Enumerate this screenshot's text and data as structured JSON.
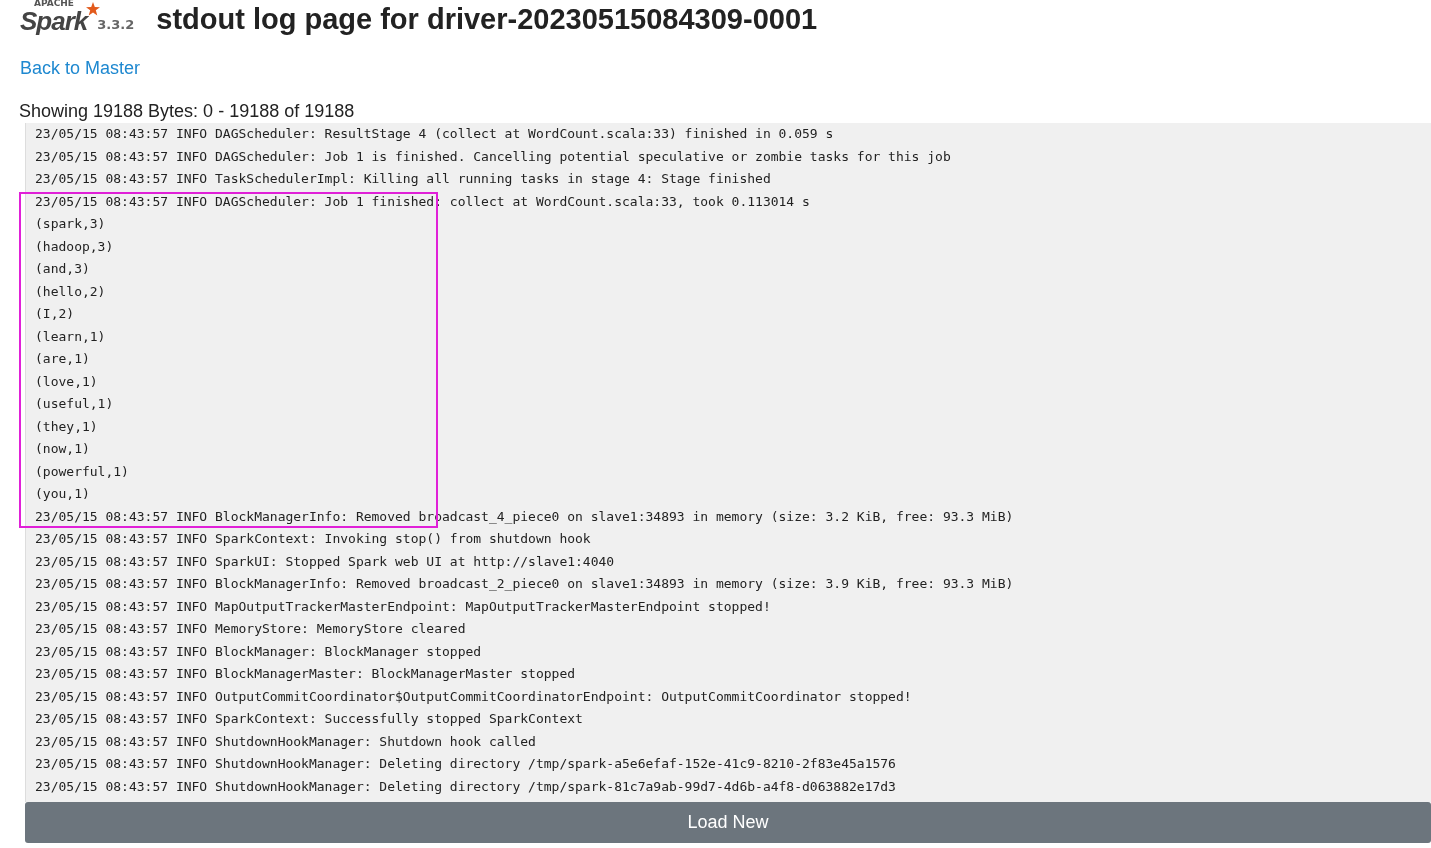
{
  "header": {
    "logo_small": "APACHE",
    "logo": "Spark",
    "version": "3.3.2",
    "title": "stdout log page for driver-20230515084309-0001"
  },
  "back_link": "Back to Master",
  "showing": "Showing 19188 Bytes: 0 - 19188 of 19188",
  "log_blocks": [
    {
      "kind": "plain",
      "lines": [
        "23/05/15 08:43:57 INFO DAGScheduler: ResultStage 4 (collect at WordCount.scala:33) finished in 0.059 s",
        "23/05/15 08:43:57 INFO DAGScheduler: Job 1 is finished. Cancelling potential speculative or zombie tasks for this job",
        "23/05/15 08:43:57 INFO TaskSchedulerImpl: Killing all running tasks in stage 4: Stage finished"
      ]
    },
    {
      "kind": "boxed",
      "lines": [
        "23/05/15 08:43:57 INFO DAGScheduler: Job 1 finished: collect at WordCount.scala:33, took 0.113014 s",
        "(spark,3)",
        "(hadoop,3)",
        "(and,3)",
        "(hello,2)",
        "(I,2)",
        "(learn,1)",
        "(are,1)",
        "(love,1)",
        "(useful,1)",
        "(they,1)",
        "(now,1)",
        "(powerful,1)",
        "(you,1)",
        "23/05/15 08:43:57 INFO BlockManagerInfo: Removed broadcast_4_piece0 on slave1:34893 in memory (size: 3.2 KiB, free: 93.3 MiB)"
      ]
    },
    {
      "kind": "plain",
      "lines": [
        "23/05/15 08:43:57 INFO SparkContext: Invoking stop() from shutdown hook",
        "23/05/15 08:43:57 INFO SparkUI: Stopped Spark web UI at http://slave1:4040",
        "23/05/15 08:43:57 INFO BlockManagerInfo: Removed broadcast_2_piece0 on slave1:34893 in memory (size: 3.9 KiB, free: 93.3 MiB)",
        "23/05/15 08:43:57 INFO MapOutputTrackerMasterEndpoint: MapOutputTrackerMasterEndpoint stopped!",
        "23/05/15 08:43:57 INFO MemoryStore: MemoryStore cleared",
        "23/05/15 08:43:57 INFO BlockManager: BlockManager stopped",
        "23/05/15 08:43:57 INFO BlockManagerMaster: BlockManagerMaster stopped",
        "23/05/15 08:43:57 INFO OutputCommitCoordinator$OutputCommitCoordinatorEndpoint: OutputCommitCoordinator stopped!",
        "23/05/15 08:43:57 INFO SparkContext: Successfully stopped SparkContext",
        "23/05/15 08:43:57 INFO ShutdownHookManager: Shutdown hook called",
        "23/05/15 08:43:57 INFO ShutdownHookManager: Deleting directory /tmp/spark-a5e6efaf-152e-41c9-8210-2f83e45a1576",
        "23/05/15 08:43:57 INFO ShutdownHookManager: Deleting directory /tmp/spark-81c7a9ab-99d7-4d6b-a4f8-d063882e17d3"
      ]
    }
  ],
  "load_button": "Load New"
}
